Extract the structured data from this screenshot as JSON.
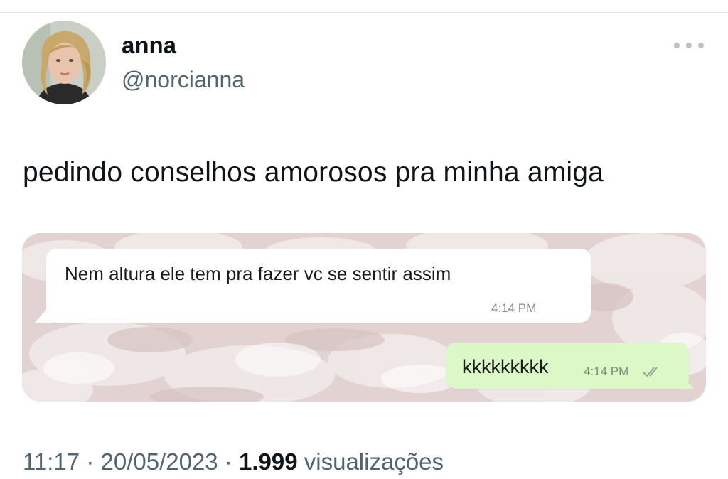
{
  "author": {
    "display_name": "anna",
    "handle": "@norcianna"
  },
  "tweet": {
    "text": "pedindo conselhos amorosos pra minha amiga"
  },
  "chat": {
    "incoming": {
      "text": "Nem altura ele tem pra fazer vc se sentir assim",
      "time": "4:14 PM"
    },
    "outgoing": {
      "text": "kkkkkkkkk",
      "time": "4:14 PM",
      "status_icon": "double-check-icon"
    }
  },
  "meta": {
    "time": "11:17",
    "separator": "·",
    "date": "20/05/2023",
    "views_count": "1.999",
    "views_label": "visualizações"
  },
  "icons": {
    "more": "more-dots-icon"
  },
  "colors": {
    "text_primary": "#0f1419",
    "text_secondary": "#536471",
    "outgoing_bubble": "#dcf8c6",
    "incoming_bubble": "#ffffff",
    "chat_background": "#e4d6d5"
  }
}
